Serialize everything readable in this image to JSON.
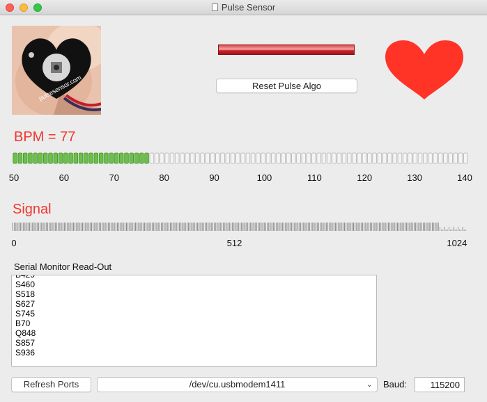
{
  "window": {
    "title": "Pulse Sensor"
  },
  "header": {
    "reset_button": "Reset Pulse Algo",
    "photo_text": "pulsesensor.com"
  },
  "bpm": {
    "label": "BPM = 77",
    "value": 77,
    "range": [
      50,
      140
    ],
    "ticks": [
      "50",
      "60",
      "70",
      "80",
      "90",
      "100",
      "110",
      "120",
      "130",
      "140"
    ]
  },
  "signal": {
    "label": "Signal",
    "level_fraction": 0.94,
    "ticks": [
      "0",
      "512",
      "1024"
    ]
  },
  "serial": {
    "label": "Serial Monitor Read-Out",
    "lines": [
      "S460",
      "S518",
      "S627",
      "S745",
      "B70",
      "Q848",
      "S857",
      "S936"
    ]
  },
  "controls": {
    "refresh_label": "Refresh Ports",
    "port_value": "/dev/cu.usbmodem1411",
    "baud_label": "Baud:",
    "baud_value": "115200"
  },
  "colors": {
    "accent_red": "#f1372c",
    "bpm_fill": "#6cc04a",
    "heart": "#ff3326"
  }
}
